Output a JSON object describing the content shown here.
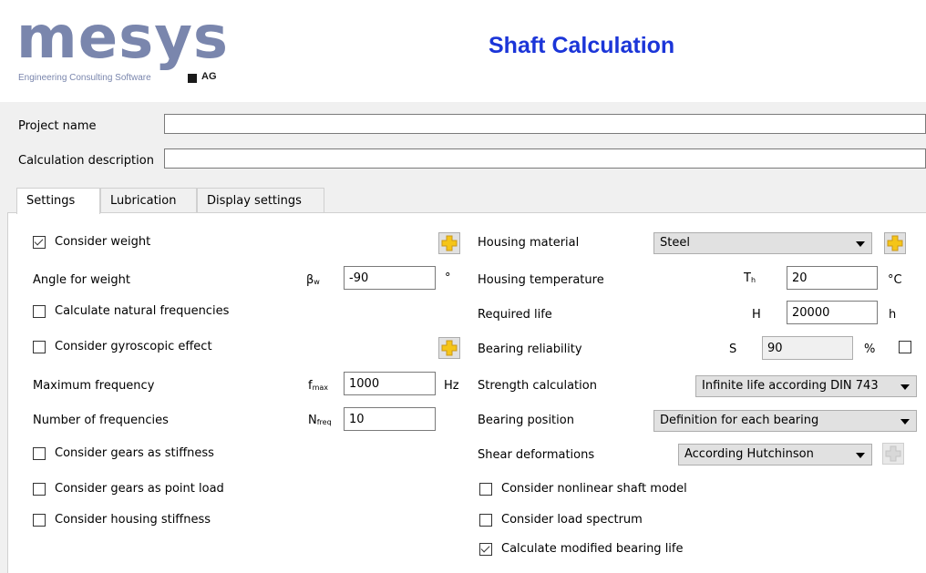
{
  "header": {
    "logo_word": "mesys",
    "logo_tagline": "Engineering Consulting Software",
    "logo_ag": "AG",
    "title": "Shaft Calculation"
  },
  "project": {
    "project_name_label": "Project name",
    "project_name_value": "",
    "calc_desc_label": "Calculation description",
    "calc_desc_value": ""
  },
  "tabs": [
    {
      "label": "Settings",
      "active": true
    },
    {
      "label": "Lubrication",
      "active": false
    },
    {
      "label": "Display settings",
      "active": false
    }
  ],
  "left": {
    "consider_weight": {
      "label": "Consider weight",
      "checked": true
    },
    "angle_weight": {
      "label": "Angle for weight",
      "symbol": "β",
      "sub": "w",
      "value": "-90",
      "unit": "°"
    },
    "calc_natural_freq": {
      "label": "Calculate natural frequencies",
      "checked": false
    },
    "gyroscopic": {
      "label": "Consider gyroscopic effect",
      "checked": false
    },
    "max_freq": {
      "label": "Maximum frequency",
      "symbol": "f",
      "sub": "max",
      "value": "1000",
      "unit": "Hz"
    },
    "num_freq": {
      "label": "Number of frequencies",
      "symbol": "N",
      "sub": "freq",
      "value": "10"
    },
    "gears_stiffness": {
      "label": "Consider gears as stiffness",
      "checked": false
    },
    "gears_point_load": {
      "label": "Consider gears as point load",
      "checked": false
    },
    "housing_stiffness": {
      "label": "Consider housing stiffness",
      "checked": false
    }
  },
  "right": {
    "housing_material": {
      "label": "Housing material",
      "value": "Steel"
    },
    "housing_temp": {
      "label": "Housing temperature",
      "symbol": "T",
      "sub": "h",
      "value": "20",
      "unit": "°C"
    },
    "required_life": {
      "label": "Required life",
      "symbol": "H",
      "value": "20000",
      "unit": "h"
    },
    "bearing_reliability": {
      "label": "Bearing reliability",
      "symbol": "S",
      "value": "90",
      "unit": "%",
      "checked": false
    },
    "strength_calc": {
      "label": "Strength calculation",
      "value": "Infinite life according DIN 743"
    },
    "bearing_position": {
      "label": "Bearing position",
      "value": "Definition for each bearing"
    },
    "shear_deform": {
      "label": "Shear deformations",
      "value": "According Hutchinson"
    },
    "nonlinear_shaft": {
      "label": "Consider nonlinear shaft model",
      "checked": false
    },
    "load_spectrum": {
      "label": "Consider load spectrum",
      "checked": false
    },
    "modified_life": {
      "label": "Calculate modified bearing life",
      "checked": true
    }
  },
  "colors": {
    "title": "#1b35d8",
    "logo": "#7a86ad",
    "plus_icon": "#f5c518"
  }
}
